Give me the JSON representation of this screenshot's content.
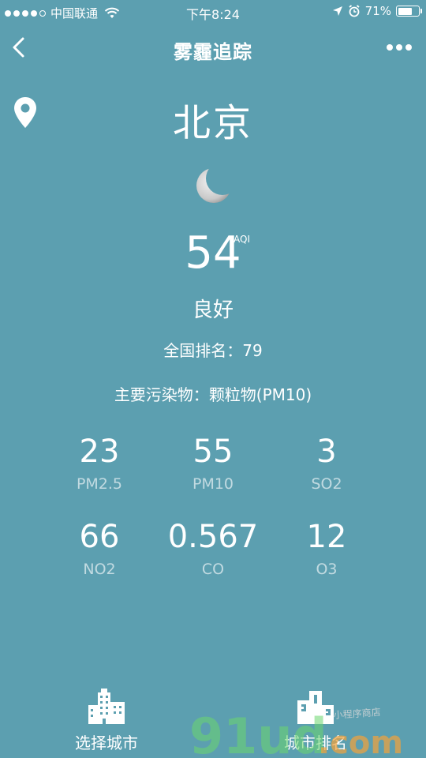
{
  "status_bar": {
    "carrier": "中国联通",
    "time": "下午8:24",
    "battery": "71%",
    "battery_level": 0.71
  },
  "nav": {
    "title": "雾霾追踪"
  },
  "city": {
    "name": "北京"
  },
  "aqi": {
    "value": "54",
    "unit": "AQI",
    "level": "良好",
    "rank_label": "全国排名：",
    "rank_value": "79",
    "pollutant_label": "主要污染物：",
    "pollutant_value": "颗粒物(PM10)"
  },
  "metrics": [
    {
      "value": "23",
      "label": "PM2.5"
    },
    {
      "value": "55",
      "label": "PM10"
    },
    {
      "value": "3",
      "label": "SO2"
    },
    {
      "value": "66",
      "label": "NO2"
    },
    {
      "value": "0.567",
      "label": "CO"
    },
    {
      "value": "12",
      "label": "O3"
    }
  ],
  "tabs": {
    "left_label": "选择城市",
    "right_label": "城市排名"
  },
  "watermark": {
    "main": "91ud",
    "suffix": ".com",
    "note": "小程序商店"
  },
  "colors": {
    "background": "#5c9fb0",
    "text": "#ffffff"
  },
  "icons": {
    "back": "chevron-left-icon",
    "more": "more-dots-icon",
    "location": "map-pin-icon",
    "weather": "moon-icon",
    "city_tab": "buildings-icon",
    "rank_tab": "podium-icon"
  }
}
